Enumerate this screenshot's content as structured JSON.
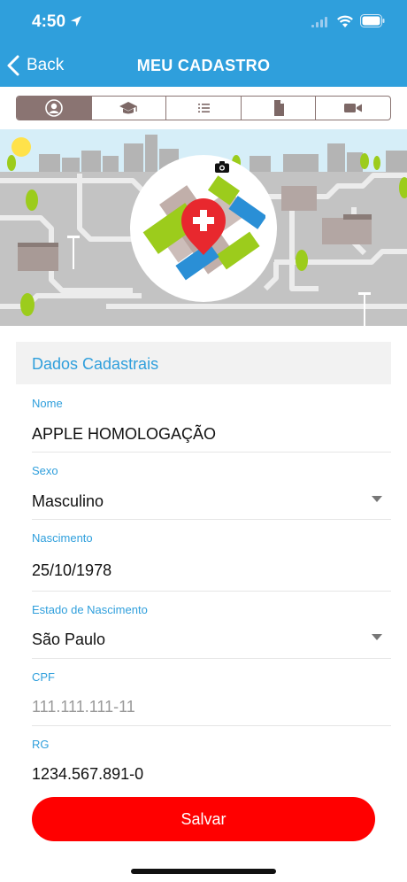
{
  "status_bar": {
    "time": "4:50"
  },
  "nav": {
    "back_label": "Back",
    "title": "MEU CADASTRO"
  },
  "tabs": [
    {
      "icon": "user-icon",
      "active": true
    },
    {
      "icon": "graduation-cap-icon",
      "active": false
    },
    {
      "icon": "list-icon",
      "active": false
    },
    {
      "icon": "document-icon",
      "active": false
    },
    {
      "icon": "video-icon",
      "active": false
    }
  ],
  "section": {
    "title": "Dados Cadastrais"
  },
  "form": {
    "nome": {
      "label": "Nome",
      "value": "APPLE HOMOLOGAÇÃO"
    },
    "sexo": {
      "label": "Sexo",
      "value": "Masculino"
    },
    "nascimento": {
      "label": "Nascimento",
      "value": "25/10/1978"
    },
    "estado": {
      "label": "Estado de Nascimento",
      "value": "São Paulo"
    },
    "cpf": {
      "label": "CPF",
      "placeholder": "111.111.111-11"
    },
    "rg": {
      "label": "RG",
      "value": "1234.567.891-0"
    }
  },
  "actions": {
    "save_label": "Salvar"
  },
  "colors": {
    "primary": "#2f9fdc",
    "tab": "#8a7472",
    "save": "#ff0000",
    "logo_red": "#e8282e",
    "logo_green": "#9ccc1c",
    "logo_blue": "#2a8fd6",
    "logo_taupe": "#b6a19b"
  }
}
